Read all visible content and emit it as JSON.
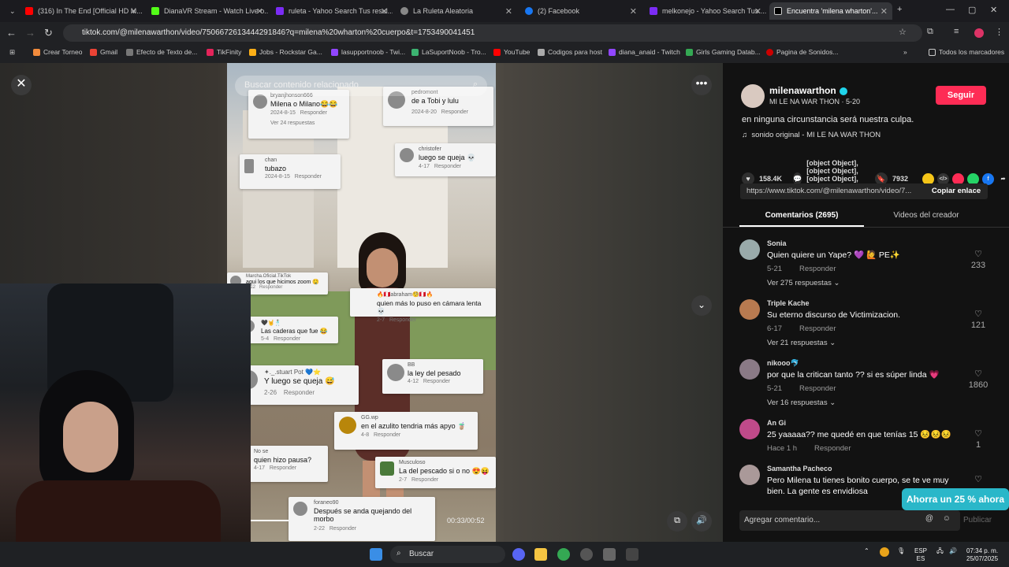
{
  "tabs": [
    {
      "title": "(316) In The End [Official HD M...",
      "color": "#ff0000"
    },
    {
      "title": "DianaVR Stream - Watch Live o...",
      "color": "#53fc18"
    },
    {
      "title": "ruleta - Yahoo Search Tus resul...",
      "color": "#7b2cf5"
    },
    {
      "title": "La Ruleta Aleatoria",
      "color": "#888"
    },
    {
      "title": "(2) Facebook",
      "color": "#1877f2"
    },
    {
      "title": "melkonejo - Yahoo Search Tus ...",
      "color": "#7b2cf5"
    },
    {
      "title": "Encuentra 'milena wharton'...",
      "color": "#111"
    }
  ],
  "url": "tiktok.com/@milenawarthon/video/7506672613444291846?q=milena%20wharton%20cuerpo&t=1753490041451",
  "bookmarks": [
    "Crear Torneo",
    "Gmail",
    "Efecto de Texto de...",
    "TikFinity",
    "Jobs - Rockstar Ga...",
    "lasupportnoob - Twi...",
    "LaSuportNoob - Tro...",
    "YouTube",
    "Codigos para host",
    "diana_anaid - Twitch",
    "Girls Gaming Datab...",
    "Pagina de Sonidos...",
    "Todos los marcadores"
  ],
  "video": {
    "search_placeholder": "Buscar contenido relacionado",
    "time": "00:33/00:52",
    "overlay_comments": [
      {
        "user": "bryanjhonson666",
        "text": "Milena o Milano😂😂",
        "date": "2024-8-15",
        "reply": "Responder",
        "more": "Ver 24 respuestas"
      },
      {
        "user": "pedromont",
        "text": "de a Tobi y lulu",
        "date": "2024-8-20",
        "reply": "Responder"
      },
      {
        "user": "christofer",
        "text": "luego se queja 💀",
        "date": "4-17",
        "reply": "Responder"
      },
      {
        "user": "chan",
        "text": "tubazo",
        "date": "2024-8-15",
        "reply": "Responder"
      },
      {
        "user": "Marcha.Oficial.TikTok",
        "text": "aqui los que hicimos zoom 🤤",
        "date": "2-12",
        "reply": "Responder"
      },
      {
        "user": "🔥🇵🇪abraham🧐🇵🇪🔥",
        "text": "quien más lo puso en cámara lenta 💀",
        "date": "2-7",
        "reply": "Responder"
      },
      {
        "user": "🖤🤘🕺🏻",
        "text": "Las caderas que fue 😂",
        "date": "5-4",
        "reply": "Responder"
      },
      {
        "user": "✦._.stuart Pot 💙⭐",
        "text": "Y luego se queja 😅",
        "date": "2-26",
        "reply": "Responder"
      },
      {
        "user": "BB",
        "text": "la ley del pesado",
        "date": "4-12",
        "reply": "Responder"
      },
      {
        "user": "GG.wp",
        "text": "en el azulito tendria más apyo 🧋",
        "date": "4-8",
        "reply": "Responder"
      },
      {
        "user": "No se",
        "text": "quien hizo pausa?",
        "date": "4-17",
        "reply": "Responder"
      },
      {
        "user": "Musculoso",
        "text": "La del pescado si o no 😍😝",
        "date": "2-7",
        "reply": "Responder"
      },
      {
        "user": "foraneo90",
        "text": "Después se anda quejando del morbo",
        "date": "2-22",
        "reply": "Responder"
      }
    ]
  },
  "panel": {
    "username": "milenawarthon",
    "subtitle": "MI LE NA WAR THON · 5-20",
    "follow": "Seguir",
    "description": "en ninguna circunstancia será nuestra culpa.",
    "sound": "sonido original - MI LE NA WAR THON",
    "likes": "158.4K",
    "comments": [
      {
        "name": "Sonia",
        "text": "Quien quiere un Yape? 💜 🙋 PE✨",
        "date": "5-21",
        "reply": "Responder",
        "replies": "Ver 275 respuestas",
        "likes": "233"
      },
      {
        "name": "Triple Kache",
        "text": "Su eterno discurso de Victimizacion.",
        "date": "6-17",
        "reply": "Responder",
        "replies": "Ver 21 respuestas",
        "likes": "121"
      },
      {
        "name": "nikooo🐬",
        "text": "por que la critican tanto ?? si es súper linda 💗",
        "date": "5-21",
        "reply": "Responder",
        "replies": "Ver 16 respuestas",
        "likes": "1860"
      },
      {
        "name": "An Gi",
        "text": "25 yaaaaa?? me quedé en que tenías 15 😣😣😣",
        "date": "Hace 1 h",
        "reply": "Responder",
        "replies": "",
        "likes": "1"
      },
      {
        "name": "Samantha Pacheco",
        "text": "Pero Milena tu tienes bonito cuerpo, se te ve muy bien. La gente es envidiosa",
        "date": "",
        "reply": "",
        "replies": "",
        "likes": ""
      }
    ],
    "saves": "7932",
    "link": "https://www.tiktok.com/@milenawarthon/video/7...",
    "copy": "Copiar enlace",
    "tab_comments": "Comentarios (2695)",
    "tab_videos": "Videos del creador",
    "add_comment": "Agregar comentario...",
    "publish": "Publicar"
  },
  "toast": "Ahorra un 25 % ahora",
  "taskbar": {
    "search": "Buscar",
    "lang1": "ESP",
    "lang2": "ES",
    "time": "07:34 p. m.",
    "date": "25/07/2025"
  }
}
